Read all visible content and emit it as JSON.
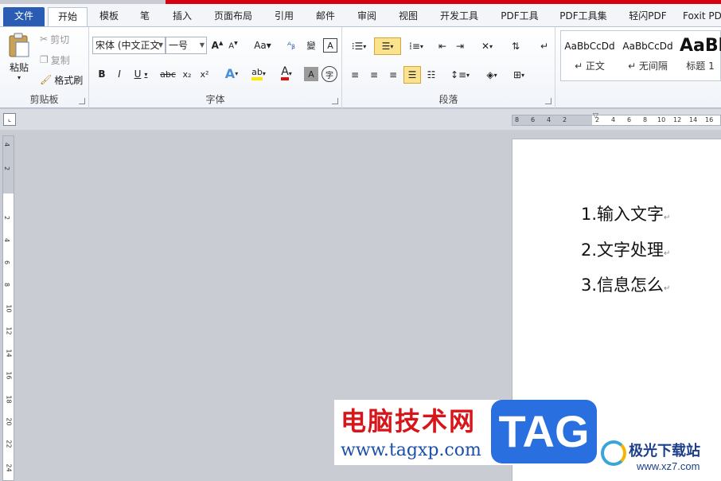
{
  "tabs": [
    {
      "label": "文件"
    },
    {
      "label": "开始"
    },
    {
      "label": "模板"
    },
    {
      "label": "笔"
    },
    {
      "label": "插入"
    },
    {
      "label": "页面布局"
    },
    {
      "label": "引用"
    },
    {
      "label": "邮件"
    },
    {
      "label": "审阅"
    },
    {
      "label": "视图"
    },
    {
      "label": "开发工具"
    },
    {
      "label": "PDF工具"
    },
    {
      "label": "PDF工具集"
    },
    {
      "label": "轻闪PDF"
    },
    {
      "label": "Foxit PD"
    }
  ],
  "clipboard": {
    "paste_label": "粘贴",
    "cut_label": "剪切",
    "copy_label": "复制",
    "format_painter_label": "格式刷",
    "group_label": "剪贴板"
  },
  "font": {
    "font_name": "宋体 (中文正文",
    "font_size": "一号",
    "group_label": "字体"
  },
  "paragraph": {
    "group_label": "段落"
  },
  "styles": [
    {
      "sample": "AaBbCcDd",
      "name": "↵ 正文"
    },
    {
      "sample": "AaBbCcDd",
      "name": "↵ 无间隔"
    },
    {
      "sample": "AaBl",
      "name": "标题 1"
    }
  ],
  "ruler": {
    "h_numbers": [
      "8",
      "6",
      "4",
      "2",
      "2",
      "4",
      "6",
      "8",
      "10",
      "12",
      "14",
      "16"
    ],
    "v_numbers": [
      "4",
      "2",
      "2",
      "4",
      "6",
      "8",
      "10",
      "12",
      "14",
      "16",
      "18",
      "20",
      "22",
      "24"
    ]
  },
  "document": {
    "lines": [
      "1.输入文字",
      "2.文字处理",
      "3.信息怎么"
    ]
  },
  "watermark": {
    "title": "电脑技术网",
    "url": "www.tagxp.com",
    "tag": "TAG",
    "site_cn": "极光下载站",
    "site_url": "www.xz7.com"
  }
}
